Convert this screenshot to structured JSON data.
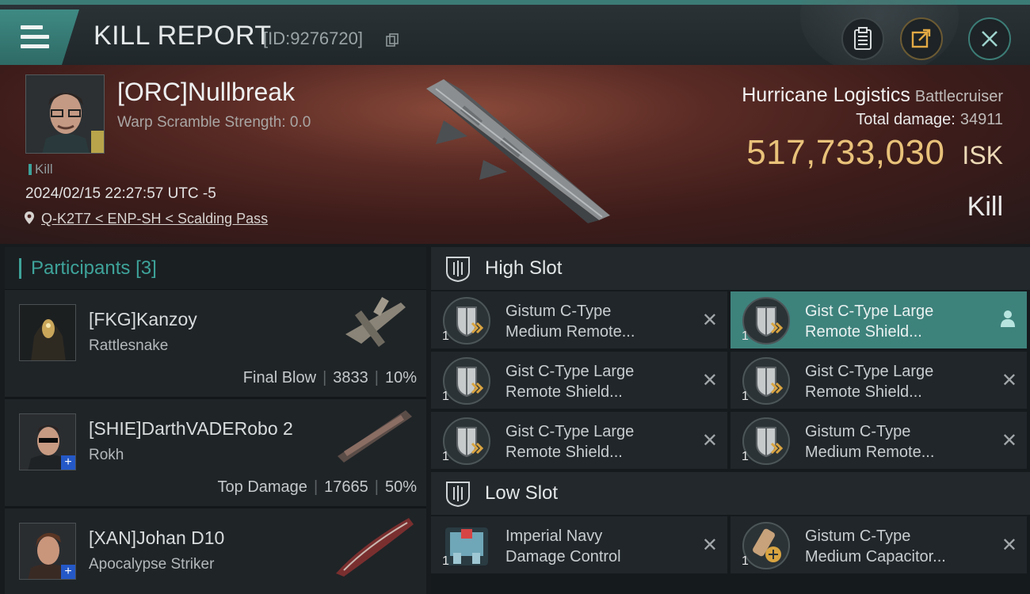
{
  "header": {
    "title": "KILL REPORT",
    "report_id": "[ID:9276720]"
  },
  "victim": {
    "name": "[ORC]Nullbreak",
    "warp": "Warp Scramble Strength: 0.0",
    "tag": "Kill",
    "timestamp": "2024/02/15 22:27:57 UTC -5",
    "location": "Q-K2T7 < ENP-SH < Scalding Pass",
    "ship": "Hurricane Logistics",
    "ship_class": "Battlecruiser",
    "total_damage_label": "Total damage:",
    "total_damage": "34911",
    "isk_value": "517,733,030",
    "isk_unit": "ISK",
    "result": "Kill"
  },
  "participants": {
    "label": "Participants",
    "count": "[3]",
    "items": [
      {
        "name": "[FKG]Kanzoy",
        "ship": "Rattlesnake",
        "role": "Final Blow",
        "damage": "3833",
        "pct": "10%",
        "plus": false
      },
      {
        "name": "[SHIE]DarthVADERobo 2",
        "ship": "Rokh",
        "role": "Top Damage",
        "damage": "17665",
        "pct": "50%",
        "plus": true
      },
      {
        "name": "[XAN]Johan D10",
        "ship": "Apocalypse Striker",
        "role": "",
        "damage": "",
        "pct": "",
        "plus": true
      }
    ]
  },
  "high_slot": {
    "label": "High Slot",
    "modules": [
      {
        "qty": "1",
        "line1": "Gistum C-Type",
        "line2": "Medium Remote...",
        "selected": false
      },
      {
        "qty": "1",
        "line1": "Gist C-Type Large",
        "line2": "Remote Shield...",
        "selected": true
      },
      {
        "qty": "1",
        "line1": "Gist C-Type Large",
        "line2": "Remote Shield...",
        "selected": false
      },
      {
        "qty": "1",
        "line1": "Gist C-Type Large",
        "line2": "Remote Shield...",
        "selected": false
      },
      {
        "qty": "1",
        "line1": "Gist C-Type Large",
        "line2": "Remote Shield...",
        "selected": false
      },
      {
        "qty": "1",
        "line1": "Gistum C-Type",
        "line2": "Medium Remote...",
        "selected": false
      }
    ]
  },
  "low_slot": {
    "label": "Low Slot",
    "modules": [
      {
        "qty": "1",
        "line1": "Imperial Navy",
        "line2": "Damage Control"
      },
      {
        "qty": "1",
        "line1": "Gistum C-Type",
        "line2": "Medium Capacitor..."
      }
    ]
  },
  "colors": {
    "accent": "#3ea39a",
    "isk": "#e9c27a",
    "selected": "#3e827c"
  }
}
